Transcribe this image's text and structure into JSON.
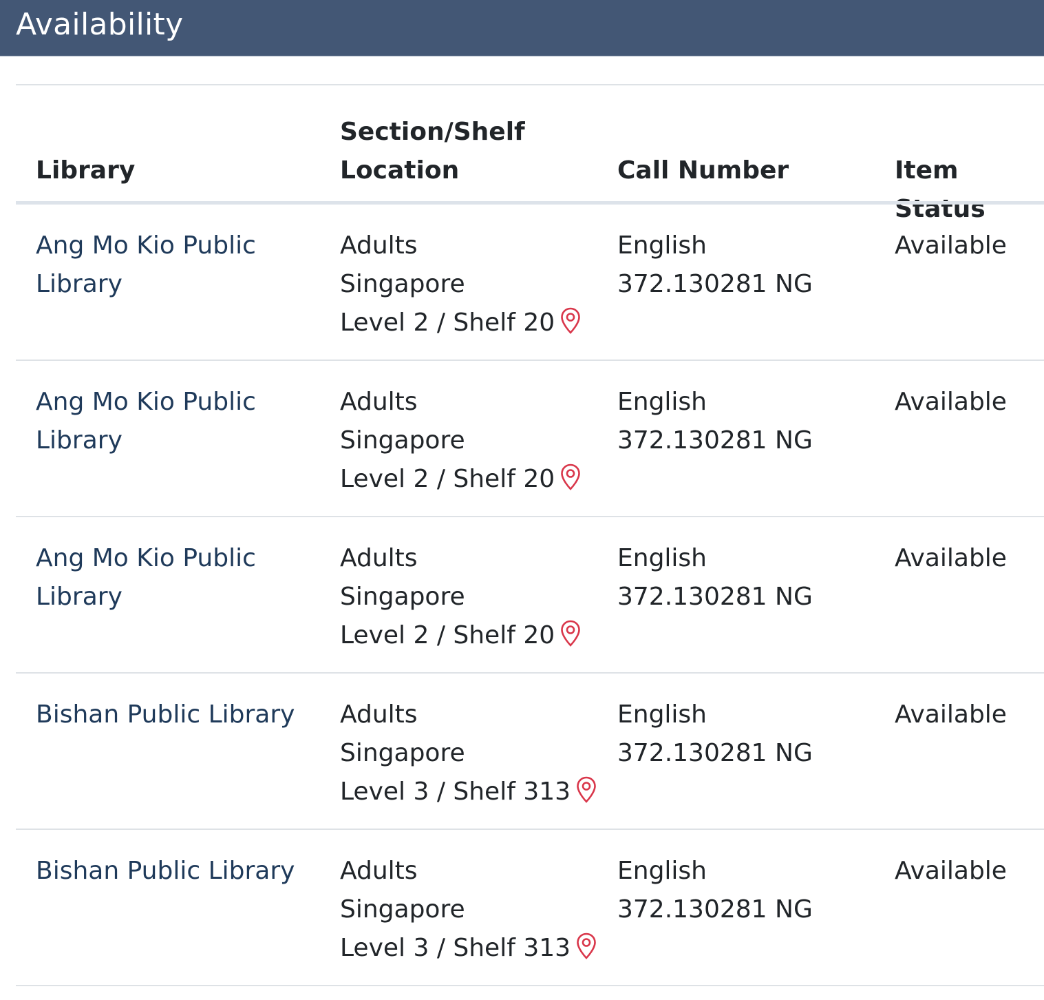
{
  "header": {
    "title": "Availability"
  },
  "table": {
    "columns": {
      "library": "Library",
      "section_line1": "Section/Shelf",
      "section_line2": "Location",
      "call_number": "Call Number",
      "item_status": "Item Status"
    },
    "rows": [
      {
        "library_line1": "Ang Mo Kio Public",
        "library_line2": "Library",
        "section": "Adults",
        "region": "Singapore",
        "shelf": "Level 2 / Shelf 20",
        "call_lang": "English",
        "call_no": "372.130281 NG",
        "status": "Available"
      },
      {
        "library_line1": "Ang Mo Kio Public",
        "library_line2": "Library",
        "section": "Adults",
        "region": "Singapore",
        "shelf": "Level 2 / Shelf 20",
        "call_lang": "English",
        "call_no": "372.130281 NG",
        "status": "Available"
      },
      {
        "library_line1": "Ang Mo Kio Public",
        "library_line2": "Library",
        "section": "Adults",
        "region": "Singapore",
        "shelf": "Level 2 / Shelf 20",
        "call_lang": "English",
        "call_no": "372.130281 NG",
        "status": "Available"
      },
      {
        "library_line1": "Bishan Public Library",
        "library_line2": "",
        "section": "Adults",
        "region": "Singapore",
        "shelf": "Level 3 / Shelf 313",
        "call_lang": "English",
        "call_no": "372.130281 NG",
        "status": "Available"
      },
      {
        "library_line1": "Bishan Public Library",
        "library_line2": "",
        "section": "Adults",
        "region": "Singapore",
        "shelf": "Level 3 / Shelf 313",
        "call_lang": "English",
        "call_no": "372.130281 NG",
        "status": "Available"
      }
    ]
  },
  "icons": {
    "location_pin": "map-pin-icon"
  },
  "colors": {
    "header_bg": "#435775",
    "library_link": "#1f3a5a",
    "pin": "#d9364a"
  }
}
